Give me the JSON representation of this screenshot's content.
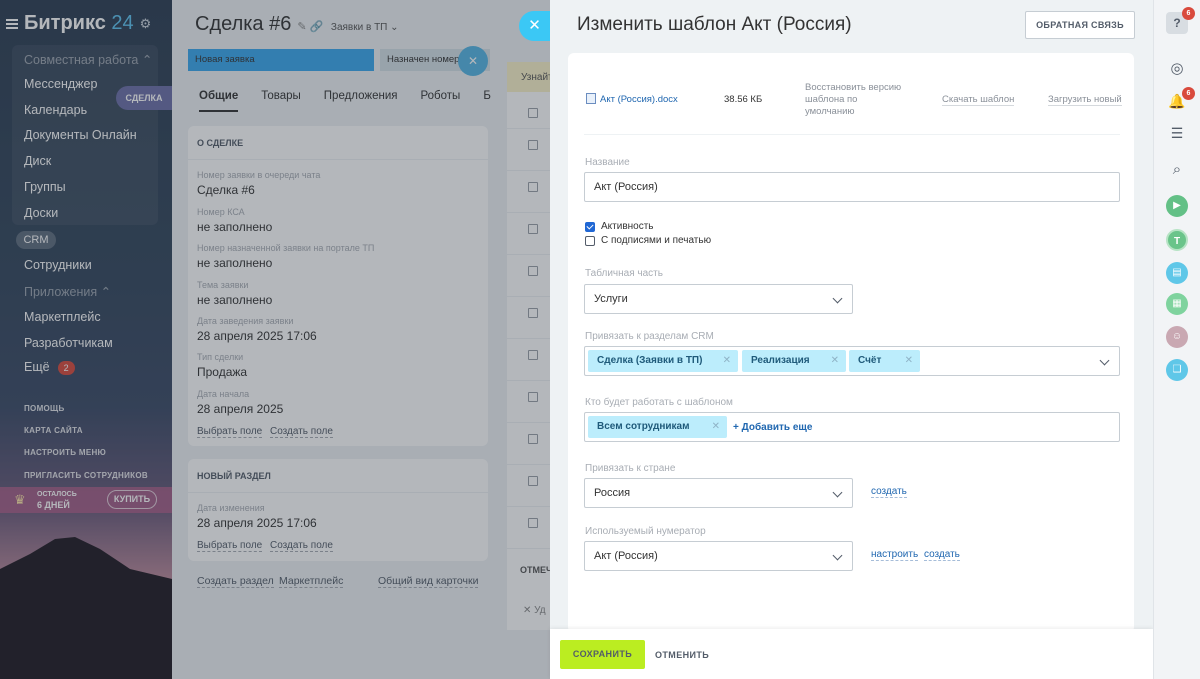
{
  "sidebar": {
    "logo_text": "Битрикс",
    "logo_num": "24",
    "items": [
      {
        "label": "Совместная работа ⌃",
        "dim": true
      },
      {
        "label": "Мессенджер"
      },
      {
        "label": "Календарь"
      },
      {
        "label": "Документы Онлайн"
      },
      {
        "label": "Диск"
      },
      {
        "label": "Группы"
      },
      {
        "label": "Доски"
      }
    ],
    "crm_label": "CRM",
    "deal_pill": "СДЕЛКА",
    "items2": [
      {
        "label": "Сотрудники"
      },
      {
        "label": "Приложения ⌃",
        "dim": true
      },
      {
        "label": "Маркетплейс"
      },
      {
        "label": "Разработчикам"
      }
    ],
    "more_label": "Ещё",
    "more_count": "2",
    "links": [
      "ПОМОЩЬ",
      "КАРТА САЙТА",
      "НАСТРОИТЬ МЕНЮ",
      "ПРИГЛАСИТЬ СОТРУДНИКОВ"
    ],
    "trial_line1": "ОСТАЛОСЬ",
    "trial_line2": "6 ДНЕЙ",
    "buy_label": "КУПИТЬ"
  },
  "deal": {
    "title": "Сделка #6",
    "category": "Заявки в ТП ⌄",
    "stage1": "Новая заявка",
    "stage2": "Назначен номер",
    "tabs": [
      "Общие",
      "Товары",
      "Предложения",
      "Роботы",
      "Б"
    ],
    "section1_title": "О СДЕЛКЕ",
    "fields": [
      {
        "label": "Номер заявки в очереди чата",
        "value": "Сделка #6"
      },
      {
        "label": "Номер КСА",
        "value": "не заполнено"
      },
      {
        "label": "Номер назначенной заявки на портале ТП",
        "value": "не заполнено"
      },
      {
        "label": "Тема заявки",
        "value": "не заполнено"
      },
      {
        "label": "Дата заведения заявки",
        "value": "28 апреля 2025 17:06"
      },
      {
        "label": "Тип сделки",
        "value": "Продажа"
      },
      {
        "label": "Дата начала",
        "value": "28 апреля 2025"
      }
    ],
    "select_field": "Выбрать поле",
    "create_field": "Создать поле",
    "section2_title": "НОВЫЙ РАЗДЕЛ",
    "field2_label": "Дата изменения",
    "field2_value": "28 апреля 2025 17:06",
    "create_section": "Создать раздел",
    "marketplace": "Маркетплейс",
    "common_view": "Общий вид карточки",
    "learn": "Узнайт",
    "mark": "ОТМЕЧ",
    "ud": "Уд"
  },
  "panel": {
    "title": "Изменить шаблон Акт (Россия)",
    "feedback": "ОБРАТНАЯ СВЯЗЬ",
    "file_name": "Акт (Россия).docx",
    "file_size": "38.56 КБ",
    "restore_line1": "Восстановить версию",
    "restore_line2": "шаблона по",
    "restore_line3": "умолчанию",
    "download": "Скачать шаблон",
    "upload": "Загрузить новый",
    "name_label": "Название",
    "name_value": "Акт (Россия)",
    "active_label": "Активность",
    "sign_label": "С подписями и печатью",
    "table_label": "Табличная часть",
    "table_value": "Услуги",
    "crm_label": "Привязать к разделам CRM",
    "crm_tags": [
      "Сделка (Заявки в ТП)",
      "Реализация",
      "Счёт"
    ],
    "who_label": "Кто будет работать с шаблоном",
    "who_tag": "Всем сотрудникам",
    "add_more": "+ Добавить еще",
    "country_label": "Привязать к стране",
    "country_value": "Россия",
    "create": "создать",
    "numerator_label": "Используемый нумератор",
    "numerator_value": "Акт (Россия)",
    "configure": "настроить",
    "create2": "создать",
    "save": "СОХРАНИТЬ",
    "cancel": "ОТМЕНИТЬ"
  },
  "rightbar": {
    "help_badge": "6",
    "bell_badge": "6",
    "avatar_letter": "Т"
  }
}
